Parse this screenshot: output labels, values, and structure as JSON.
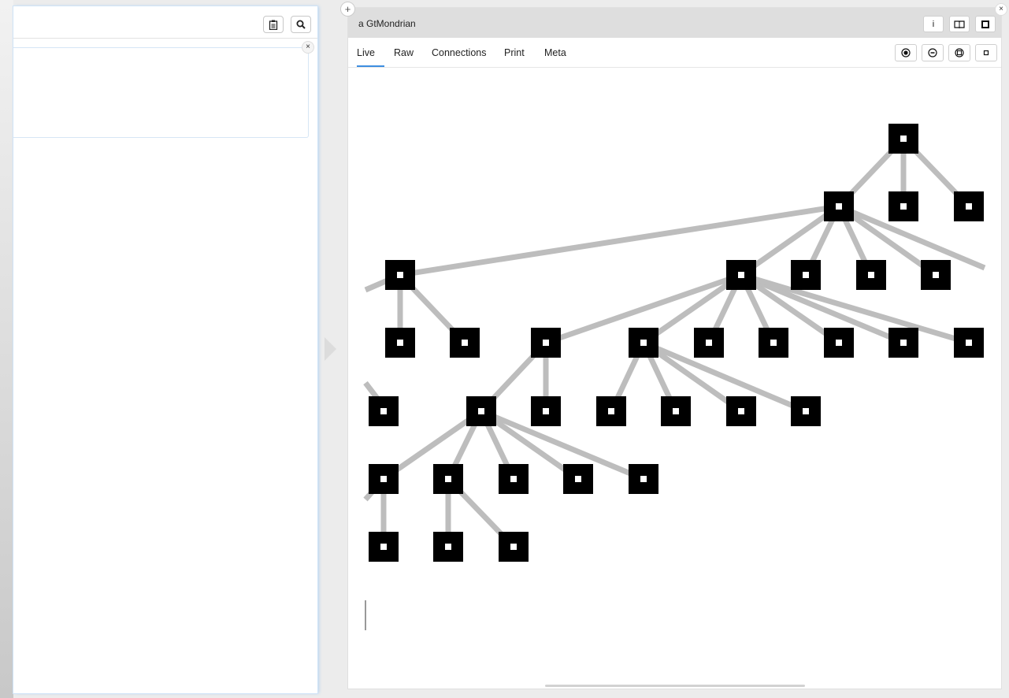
{
  "left_pane": {
    "toolbar": {
      "clipboard_icon": "clipboard-icon",
      "search_icon": "search-icon"
    }
  },
  "right_pane": {
    "title": "a GtMondrian",
    "header_buttons": [
      "i",
      "book-icon",
      "square-icon"
    ],
    "tabs": [
      {
        "label": "Live"
      },
      {
        "label": "Raw"
      },
      {
        "label": "Connections"
      },
      {
        "label": "Print"
      },
      {
        "label": "Meta"
      }
    ],
    "active_tab": "Live",
    "zoom_controls": [
      "zoom-in-icon",
      "zoom-out-icon",
      "zoom-fit-icon",
      "zoom-reset-icon"
    ]
  },
  "colors": {
    "node": "#000000",
    "edge": "#bdbdbd",
    "accent": "#3d8ee0"
  }
}
